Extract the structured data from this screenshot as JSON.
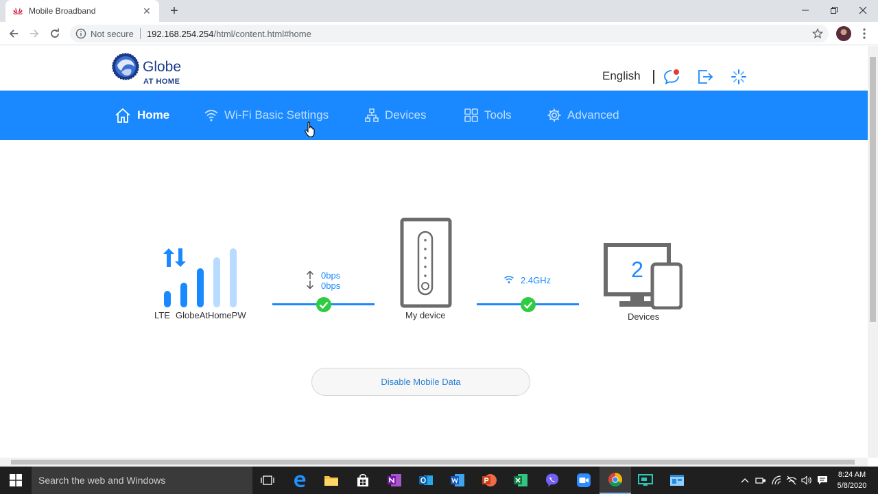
{
  "browser": {
    "tab_title": "Mobile Broadband",
    "not_secure": "Not secure",
    "url_host": "192.168.254.254",
    "url_path": "/html/content.html#home"
  },
  "header": {
    "logo_name": "Globe",
    "logo_sub": "AT HOME",
    "language": "English"
  },
  "nav": {
    "items": [
      {
        "label": "Home",
        "icon": "home-icon",
        "active": true
      },
      {
        "label": "Wi-Fi Basic Settings",
        "icon": "wifi-icon",
        "active": false
      },
      {
        "label": "Devices",
        "icon": "devices-network-icon",
        "active": false
      },
      {
        "label": "Tools",
        "icon": "tools-grid-icon",
        "active": false
      },
      {
        "label": "Advanced",
        "icon": "gear-icon",
        "active": false
      }
    ]
  },
  "status": {
    "network_type": "LTE",
    "network_name": "GlobeAtHomePW",
    "upload_rate": "0bps",
    "download_rate": "0bps",
    "router_label": "My device",
    "wifi_band": "2.4GHz",
    "device_count": "2",
    "devices_label": "Devices",
    "signal_bars_lit": 3,
    "signal_bars_total": 5
  },
  "actions": {
    "disable_mobile_data": "Disable Mobile Data"
  },
  "taskbar": {
    "search_placeholder": "Search the web and Windows",
    "time": "8:24 AM",
    "date": "5/8/2020"
  },
  "colors": {
    "accent": "#1a89ff",
    "ok": "#2ecc40"
  }
}
